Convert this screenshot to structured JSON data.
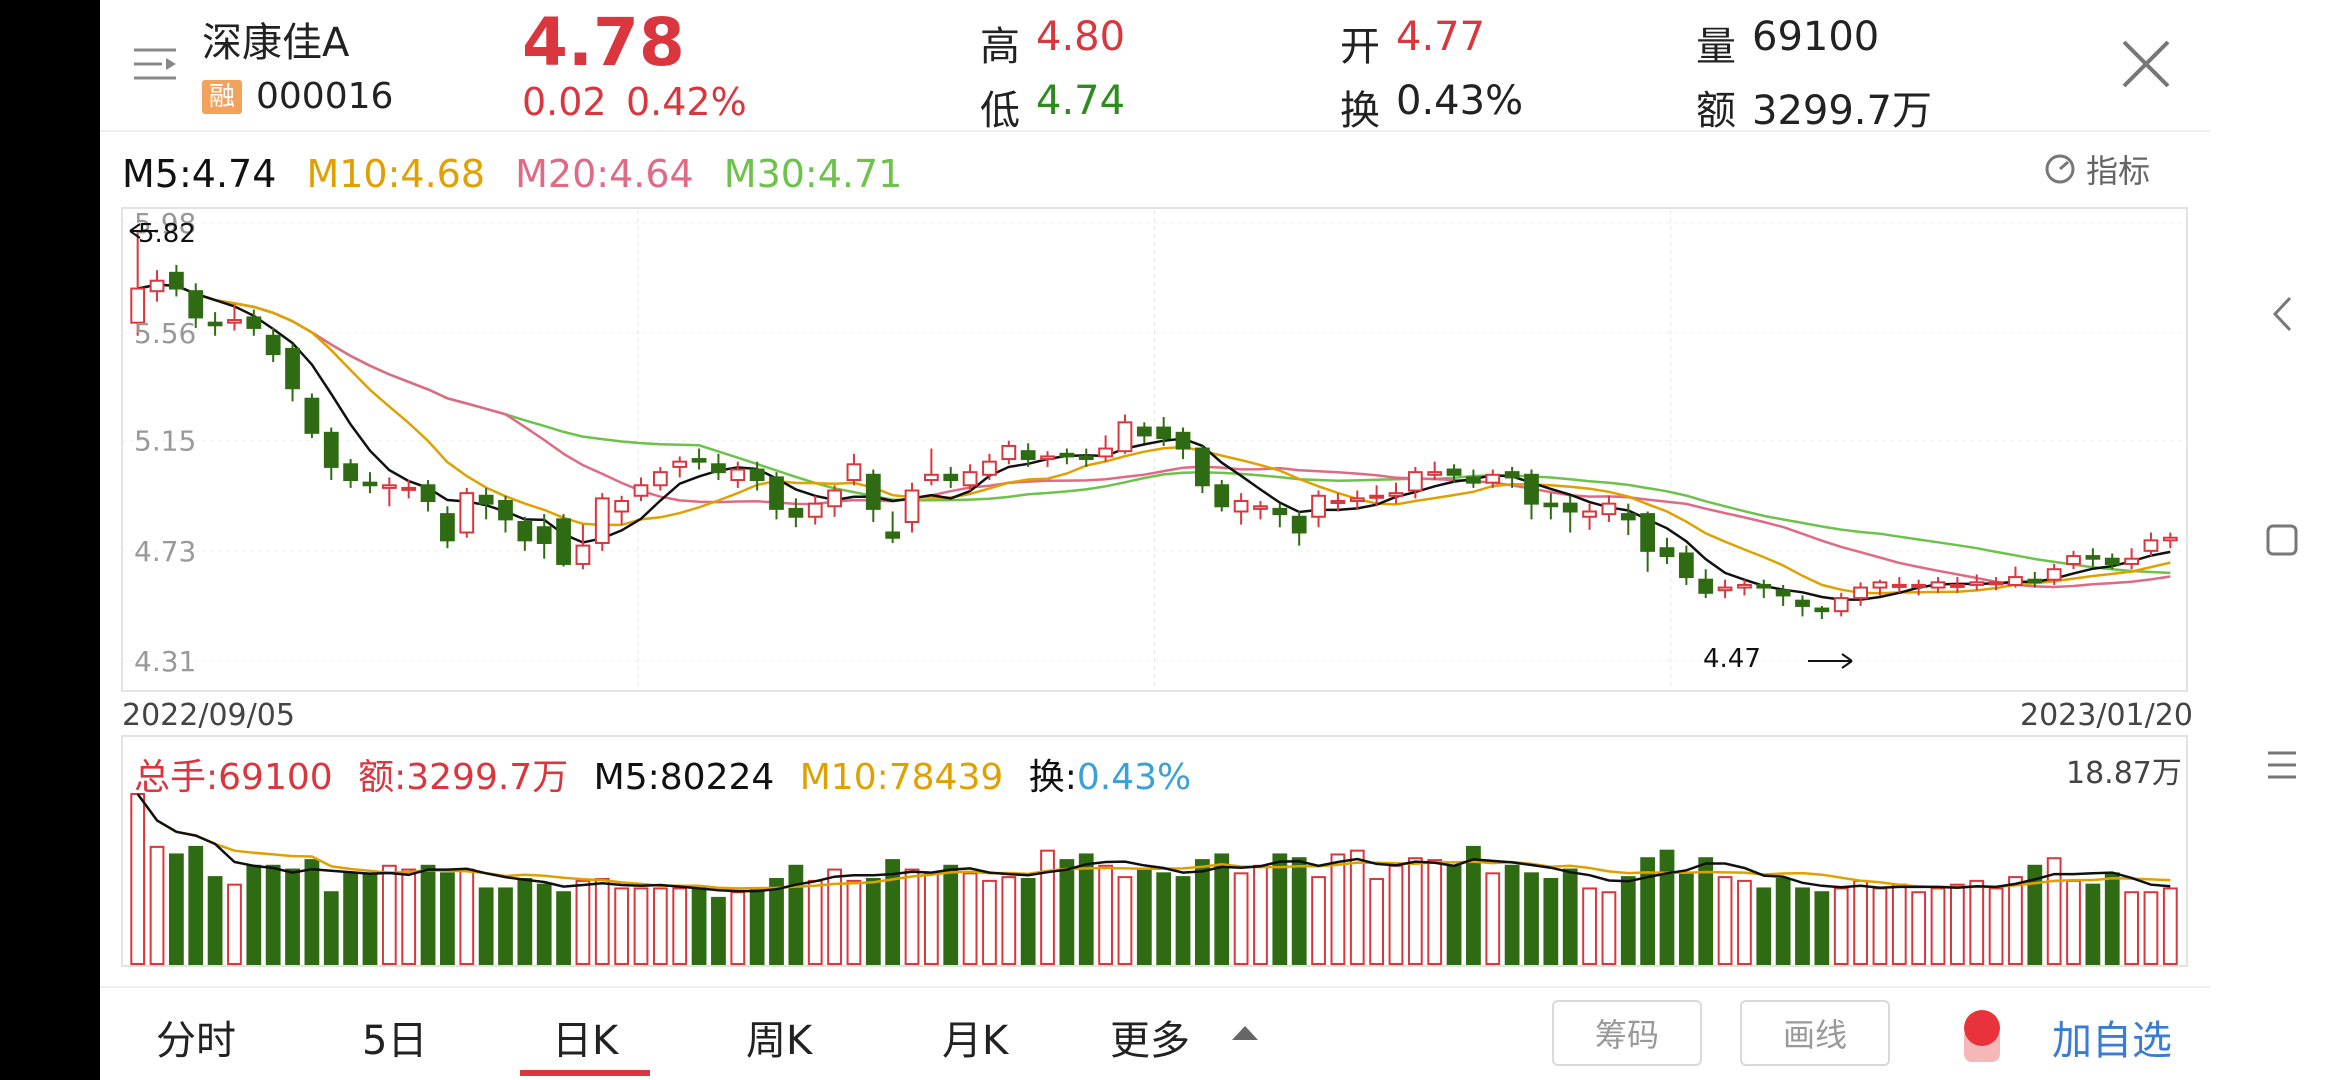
{
  "header": {
    "stock_name": "深康佳A",
    "badge": "融",
    "code": "000016",
    "price": "4.78",
    "change": "0.02",
    "change_pct": "0.42%",
    "high_label": "高",
    "high": "4.80",
    "open_label": "开",
    "open": "4.77",
    "volume_label": "量",
    "volume": "69100",
    "low_label": "低",
    "low": "4.74",
    "turnover_label": "换",
    "turnover": "0.43%",
    "amount_label": "额",
    "amount": "3299.7万"
  },
  "ma_line": {
    "m5": "M5:4.74",
    "m10": "M10:4.68",
    "m20": "M20:4.64",
    "m30": "M30:4.71",
    "indicator": "指标"
  },
  "price_axis": [
    "5.98",
    "5.56",
    "5.15",
    "4.73",
    "4.31"
  ],
  "date_start": "2022/09/05",
  "date_end": "2023/01/20",
  "max_marker": "5.82",
  "min_marker": "4.47",
  "vol_line": {
    "total": "总手:69100",
    "amount": "额:3299.7万",
    "m5": "M5:80224",
    "m10": "M10:78439",
    "turnover_label": "换:",
    "turnover": "0.43%",
    "max": "18.87万"
  },
  "tabs": [
    "分时",
    "5日",
    "日K",
    "周K",
    "月K",
    "更多"
  ],
  "active_tab": "日K",
  "buttons": {
    "chips": "筹码",
    "draw": "画线",
    "add": "加自选"
  },
  "colors": {
    "up": "#d9363e",
    "down": "#2e6b12",
    "m5": "#111111",
    "m10": "#e0a100",
    "m20": "#e06a86",
    "m30": "#6cc24a",
    "accent": "#3a7bd5"
  },
  "chart_data": {
    "type": "candlestick",
    "ylim": [
      4.31,
      5.98
    ],
    "x_start": "2022/09/05",
    "x_end": "2023/01/20",
    "ohlc": [
      [
        5.6,
        5.73,
        5.95,
        5.55
      ],
      [
        5.72,
        5.76,
        5.8,
        5.68
      ],
      [
        5.79,
        5.73,
        5.82,
        5.7
      ],
      [
        5.72,
        5.62,
        5.75,
        5.58
      ],
      [
        5.6,
        5.59,
        5.64,
        5.55
      ],
      [
        5.6,
        5.61,
        5.67,
        5.57
      ],
      [
        5.62,
        5.58,
        5.65,
        5.55
      ],
      [
        5.55,
        5.48,
        5.58,
        5.45
      ],
      [
        5.5,
        5.35,
        5.52,
        5.3
      ],
      [
        5.31,
        5.18,
        5.33,
        5.16
      ],
      [
        5.18,
        5.05,
        5.2,
        5.0
      ],
      [
        5.06,
        5.0,
        5.08,
        4.97
      ],
      [
        4.99,
        4.98,
        5.03,
        4.95
      ],
      [
        4.97,
        4.98,
        5.01,
        4.9
      ],
      [
        4.97,
        4.97,
        5.0,
        4.93
      ],
      [
        4.98,
        4.92,
        5.0,
        4.88
      ],
      [
        4.87,
        4.77,
        4.9,
        4.74
      ],
      [
        4.8,
        4.95,
        4.97,
        4.78
      ],
      [
        4.94,
        4.91,
        4.97,
        4.85
      ],
      [
        4.92,
        4.85,
        4.94,
        4.8
      ],
      [
        4.84,
        4.77,
        4.86,
        4.73
      ],
      [
        4.82,
        4.76,
        4.87,
        4.7
      ],
      [
        4.85,
        4.68,
        4.87,
        4.67
      ],
      [
        4.68,
        4.75,
        4.83,
        4.66
      ],
      [
        4.76,
        4.93,
        4.95,
        4.73
      ],
      [
        4.88,
        4.92,
        4.94,
        4.83
      ],
      [
        4.94,
        4.98,
        5.01,
        4.92
      ],
      [
        4.98,
        5.03,
        5.05,
        4.96
      ],
      [
        5.05,
        5.07,
        5.09,
        5.01
      ],
      [
        5.08,
        5.07,
        5.12,
        5.04
      ],
      [
        5.06,
        5.03,
        5.1,
        5.0
      ],
      [
        5.0,
        5.04,
        5.07,
        4.97
      ],
      [
        5.04,
        5.0,
        5.07,
        4.96
      ],
      [
        5.01,
        4.89,
        5.03,
        4.85
      ],
      [
        4.89,
        4.86,
        4.93,
        4.82
      ],
      [
        4.86,
        4.91,
        4.94,
        4.83
      ],
      [
        4.9,
        4.96,
        4.98,
        4.86
      ],
      [
        5.0,
        5.06,
        5.1,
        4.98
      ],
      [
        5.02,
        4.89,
        5.04,
        4.84
      ],
      [
        4.8,
        4.78,
        4.88,
        4.76
      ],
      [
        4.84,
        4.96,
        4.99,
        4.8
      ],
      [
        5.0,
        5.02,
        5.12,
        4.98
      ],
      [
        5.02,
        5.0,
        5.05,
        4.97
      ],
      [
        4.98,
        5.03,
        5.06,
        4.96
      ],
      [
        5.02,
        5.07,
        5.1,
        5.0
      ],
      [
        5.08,
        5.13,
        5.15,
        5.06
      ],
      [
        5.11,
        5.08,
        5.14,
        5.05
      ],
      [
        5.08,
        5.09,
        5.11,
        5.05
      ],
      [
        5.1,
        5.09,
        5.12,
        5.06
      ],
      [
        5.09,
        5.08,
        5.12,
        5.05
      ],
      [
        5.09,
        5.12,
        5.17,
        5.07
      ],
      [
        5.11,
        5.22,
        5.25,
        5.1
      ],
      [
        5.2,
        5.17,
        5.22,
        5.14
      ],
      [
        5.2,
        5.16,
        5.24,
        5.13
      ],
      [
        5.18,
        5.12,
        5.2,
        5.08
      ],
      [
        5.12,
        4.98,
        5.13,
        4.95
      ],
      [
        4.98,
        4.9,
        5.0,
        4.88
      ],
      [
        4.88,
        4.92,
        4.95,
        4.83
      ],
      [
        4.89,
        4.9,
        4.92,
        4.85
      ],
      [
        4.89,
        4.87,
        4.91,
        4.82
      ],
      [
        4.86,
        4.8,
        4.88,
        4.75
      ],
      [
        4.86,
        4.94,
        4.96,
        4.82
      ],
      [
        4.92,
        4.92,
        4.95,
        4.88
      ],
      [
        4.92,
        4.93,
        4.96,
        4.89
      ],
      [
        4.94,
        4.94,
        4.98,
        4.9
      ],
      [
        4.94,
        4.95,
        4.99,
        4.91
      ],
      [
        4.96,
        5.03,
        5.05,
        4.93
      ],
      [
        5.02,
        5.03,
        5.07,
        5.0
      ],
      [
        5.04,
        5.02,
        5.06,
        4.99
      ],
      [
        5.01,
        4.99,
        5.04,
        4.97
      ],
      [
        4.99,
        5.02,
        5.04,
        4.97
      ],
      [
        5.03,
        5.01,
        5.05,
        4.97
      ],
      [
        5.02,
        4.91,
        5.04,
        4.85
      ],
      [
        4.91,
        4.9,
        4.95,
        4.85
      ],
      [
        4.91,
        4.88,
        4.94,
        4.8
      ],
      [
        4.86,
        4.88,
        4.91,
        4.81
      ],
      [
        4.87,
        4.91,
        4.94,
        4.84
      ],
      [
        4.87,
        4.85,
        4.91,
        4.79
      ],
      [
        4.87,
        4.73,
        4.88,
        4.65
      ],
      [
        4.74,
        4.71,
        4.78,
        4.68
      ],
      [
        4.72,
        4.63,
        4.75,
        4.6
      ],
      [
        4.62,
        4.57,
        4.66,
        4.55
      ],
      [
        4.58,
        4.59,
        4.62,
        4.55
      ],
      [
        4.59,
        4.6,
        4.62,
        4.56
      ],
      [
        4.6,
        4.59,
        4.62,
        4.55
      ],
      [
        4.58,
        4.56,
        4.6,
        4.52
      ],
      [
        4.54,
        4.52,
        4.56,
        4.48
      ],
      [
        4.51,
        4.5,
        4.52,
        4.47
      ],
      [
        4.5,
        4.55,
        4.57,
        4.48
      ],
      [
        4.55,
        4.59,
        4.61,
        4.52
      ],
      [
        4.59,
        4.61,
        4.62,
        4.56
      ],
      [
        4.6,
        4.6,
        4.63,
        4.57
      ],
      [
        4.6,
        4.6,
        4.62,
        4.56
      ],
      [
        4.59,
        4.61,
        4.63,
        4.57
      ],
      [
        4.6,
        4.6,
        4.63,
        4.57
      ],
      [
        4.6,
        4.61,
        4.64,
        4.58
      ],
      [
        4.61,
        4.61,
        4.63,
        4.58
      ],
      [
        4.6,
        4.63,
        4.67,
        4.59
      ],
      [
        4.62,
        4.61,
        4.65,
        4.59
      ],
      [
        4.62,
        4.66,
        4.68,
        4.6
      ],
      [
        4.68,
        4.71,
        4.73,
        4.66
      ],
      [
        4.71,
        4.7,
        4.74,
        4.67
      ],
      [
        4.7,
        4.68,
        4.72,
        4.66
      ],
      [
        4.68,
        4.7,
        4.74,
        4.66
      ],
      [
        4.73,
        4.77,
        4.8,
        4.71
      ],
      [
        4.77,
        4.78,
        4.8,
        4.74
      ]
    ],
    "ma_end": {
      "M5": 4.74,
      "M10": 4.68,
      "M20": 4.64,
      "M30": 4.71
    },
    "volume_max": "18.87万"
  }
}
